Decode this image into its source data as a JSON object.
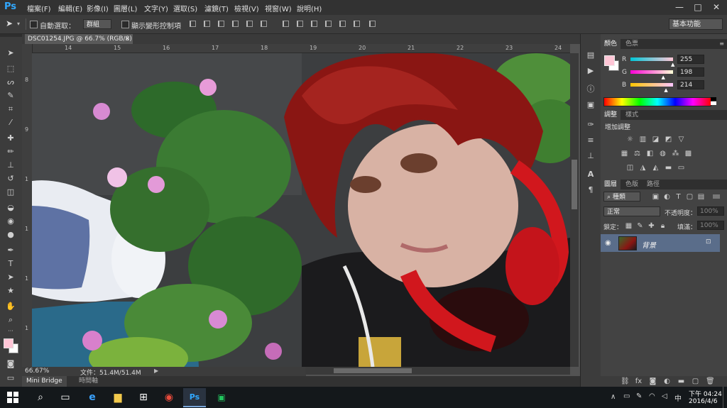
{
  "app": {
    "logo": "Ps",
    "title": "Adobe Photoshop CS6"
  },
  "menu": [
    "檔案(F)",
    "編輯(E)",
    "影像(I)",
    "圖層(L)",
    "文字(Y)",
    "選取(S)",
    "濾鏡(T)",
    "檢視(V)",
    "視窗(W)",
    "說明(H)"
  ],
  "window_controls": {
    "minimize": "—",
    "maximize": "□",
    "close": "✕"
  },
  "options_bar": {
    "auto_select_label": "自動選取：",
    "auto_select_value": "群組",
    "show_transform_label": "顯示變形控制項",
    "workspace": "基本功能"
  },
  "document": {
    "tab_title": "DSC01254.JPG @ 66.7% (RGB/8) *",
    "tab_close": "×",
    "ruler_top": [
      "14",
      "15",
      "16",
      "17",
      "18",
      "19",
      "20",
      "21",
      "22",
      "23",
      "24"
    ],
    "ruler_left": [
      "8",
      "9",
      "1",
      "1",
      "1",
      "1",
      "1",
      "1"
    ],
    "zoom": "66.67%",
    "file_info": "文件：51.4M/51.4M"
  },
  "bottom_tabs": [
    "Mini Bridge",
    "時間軸"
  ],
  "color_panel": {
    "tabs": [
      "顏色",
      "色票"
    ],
    "labels": [
      "R",
      "G",
      "B"
    ],
    "values": [
      "255",
      "198",
      "214"
    ],
    "r_fraction": 1.0,
    "g_fraction": 0.776,
    "b_fraction": 0.839,
    "foreground": "#ffc6d6",
    "background": "#ffffff"
  },
  "adjustments_panel": {
    "tabs": [
      "調整",
      "樣式"
    ],
    "title": "增加調整"
  },
  "layers_panel": {
    "tabs": [
      "圖層",
      "色版",
      "路徑"
    ],
    "filter_label": "種類",
    "blend_mode": "正常",
    "opacity_label": "不透明度：",
    "opacity_value": "100%",
    "lock_label": "鎖定：",
    "fill_label": "填滿：",
    "fill_value": "100%",
    "layers": [
      {
        "name": "背景",
        "visible": true,
        "locked": true
      }
    ]
  },
  "taskbar": {
    "apps": [
      "search-icon",
      "task-view-icon",
      "edge-icon",
      "file-explorer-icon",
      "store-icon",
      "chrome-icon",
      "photoshop-icon",
      "line-icon"
    ],
    "time_prefix": "下午",
    "time": "04:24",
    "date": "2016/4/6"
  }
}
